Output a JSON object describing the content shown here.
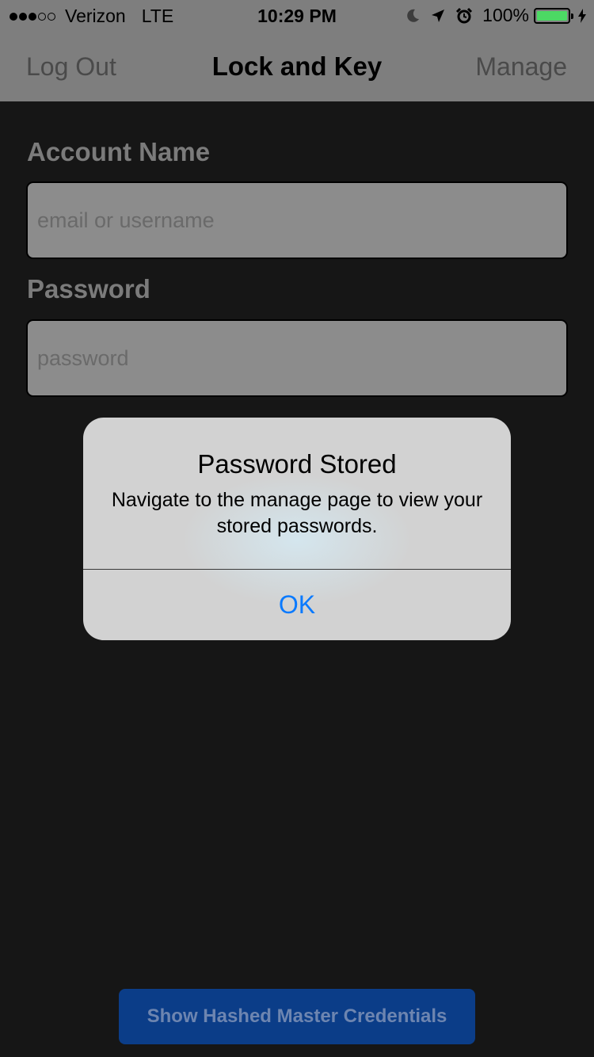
{
  "status_bar": {
    "carrier": "Verizon",
    "network": "LTE",
    "time": "10:29 PM",
    "battery_percent": "100%",
    "signal_bars_filled": 3,
    "signal_bars_total": 5,
    "battery_level": 1.0,
    "icons": [
      "moon-icon",
      "location-arrow-icon",
      "alarm-clock-icon",
      "battery-icon",
      "charging-bolt-icon"
    ]
  },
  "nav": {
    "left_button": "Log Out",
    "title": "Lock and Key",
    "right_button": "Manage"
  },
  "form": {
    "account_label": "Account Name",
    "account_placeholder": "email or username",
    "account_value": "",
    "password_label": "Password",
    "password_placeholder": "password",
    "password_value": ""
  },
  "bottom_button": {
    "label": "Show Hashed Master Credentials"
  },
  "alert": {
    "title": "Password Stored",
    "message": "Navigate to the manage page to view your stored passwords.",
    "ok_label": "OK"
  },
  "colors": {
    "bar_background": "#7e7e7e",
    "page_background": "#161616",
    "alert_button": "#0a7aff",
    "bottom_button_background": "#0b3d88",
    "battery_fill": "#4cd964"
  }
}
